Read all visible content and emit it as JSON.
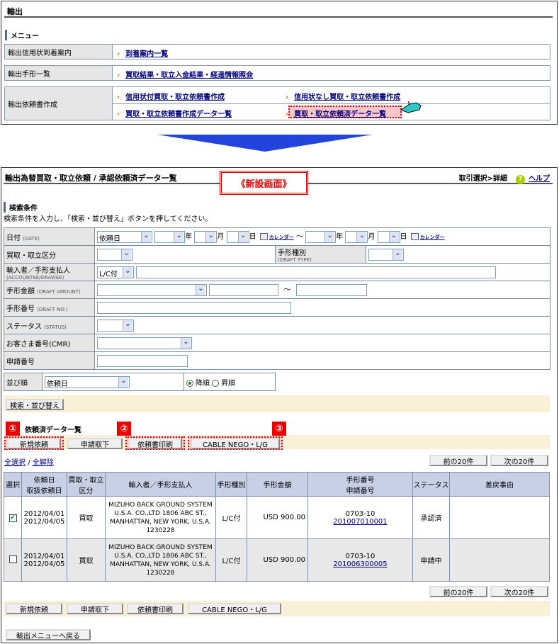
{
  "top": {
    "title": "輸出",
    "menu_heading": "メニュー",
    "rows": [
      {
        "label": "輸出信用状到着案内",
        "links": [
          "到着案内一覧"
        ]
      },
      {
        "label": "輸出手形一覧",
        "links": [
          "買取結果・取立入金結果・経過情報照会"
        ]
      },
      {
        "label": "輸出依頼書作成",
        "links": [
          "信用状付買取・取立依頼書作成",
          "信用状なし買取・取立依頼書作成",
          "買取・取立依頼書作成データ一覧",
          "買取・取立依頼済データ一覧"
        ]
      }
    ]
  },
  "main": {
    "title": "輸出為替買取・取立依頼 / 承認依頼済データ一覧",
    "new_screen": "《新設画面》",
    "nav": "取引選択>詳細",
    "help": "ヘルプ"
  },
  "search": {
    "heading": "検索条件",
    "instruction": "検索条件を入力し、「検索・並び替え」ボタンを押してください。",
    "date_label": "日付",
    "date_sub": "(DATE)",
    "date_type": "依頼日",
    "year": "年",
    "month": "月",
    "day": "日",
    "calendar": "カレンダー",
    "tilde": "～",
    "kubun_label": "買取・取立区分",
    "draft_type_label": "手形種別",
    "draft_type_sub": "(DRAFT TYPE)",
    "accountee_label": "輸入者／手形支払人",
    "accountee_sub": "(ACCOUNTEE/DRAWEE)",
    "lc_value": "L/C付",
    "amount_label": "手形金額",
    "amount_sub": "(DRAFT AMOUNT)",
    "draftno_label": "手形番号",
    "draftno_sub": "(DRAFT NO.)",
    "status_label": "ステータス",
    "status_sub": "(STATUS)",
    "cmr_label": "お客さま番号(CMR)",
    "app_label": "申請番号",
    "sort_label": "並び順",
    "sort_value": "依頼日",
    "desc": "降順",
    "asc": "昇順",
    "search_btn": "検索・並び替え"
  },
  "list": {
    "heading": "依頼済データ一覧",
    "buttons": [
      "新規依頼",
      "申請取下",
      "依頼書印刷",
      "CABLE NEGO・L/G"
    ],
    "marks": [
      "①",
      "②",
      "③"
    ],
    "select_all": "全選択",
    "slash": "/",
    "clear_all": "全解除",
    "prev": "前の20件",
    "next": "次の20件",
    "headers": [
      "選択",
      "依頼日\n取扱依頼日",
      "買取・取立\n区分",
      "輸入者／手形支払人",
      "手形種別",
      "手形金額",
      "手形番号\n申請番号",
      "ステータス",
      "差戻事由"
    ],
    "rows": [
      {
        "checked": true,
        "dates": [
          "2012/04/01",
          "2012/04/05"
        ],
        "kubun": "買取",
        "accountee": [
          "MIZUHO BACK GROUND SYSTEM",
          "U.S.A. CO.,LTD 1806 ABC ST.,",
          "MANHATTAN, NEW YORK, U.S.A.",
          "1230228"
        ],
        "type": "L/C付",
        "amount": "USD 900.00",
        "draft_no": "0703-10",
        "app_no": "201007010001",
        "status": "承認済",
        "reason": ""
      },
      {
        "checked": false,
        "dates": [
          "2012/04/01",
          "2012/04/05"
        ],
        "kubun": "買取",
        "accountee": [
          "MIZUHO BACK GROUND SYSTEM",
          "U.S.A. CO.,LTD 1806 ABC ST.,",
          "MANHATTAN, NEW YORK, U.S.A.",
          "1230228"
        ],
        "type": "L/C付",
        "amount": "USD 900.00",
        "draft_no": "0703-10",
        "app_no": "201006300005",
        "status": "申請中",
        "reason": ""
      }
    ],
    "back": "輸出メニューへ戻る"
  }
}
